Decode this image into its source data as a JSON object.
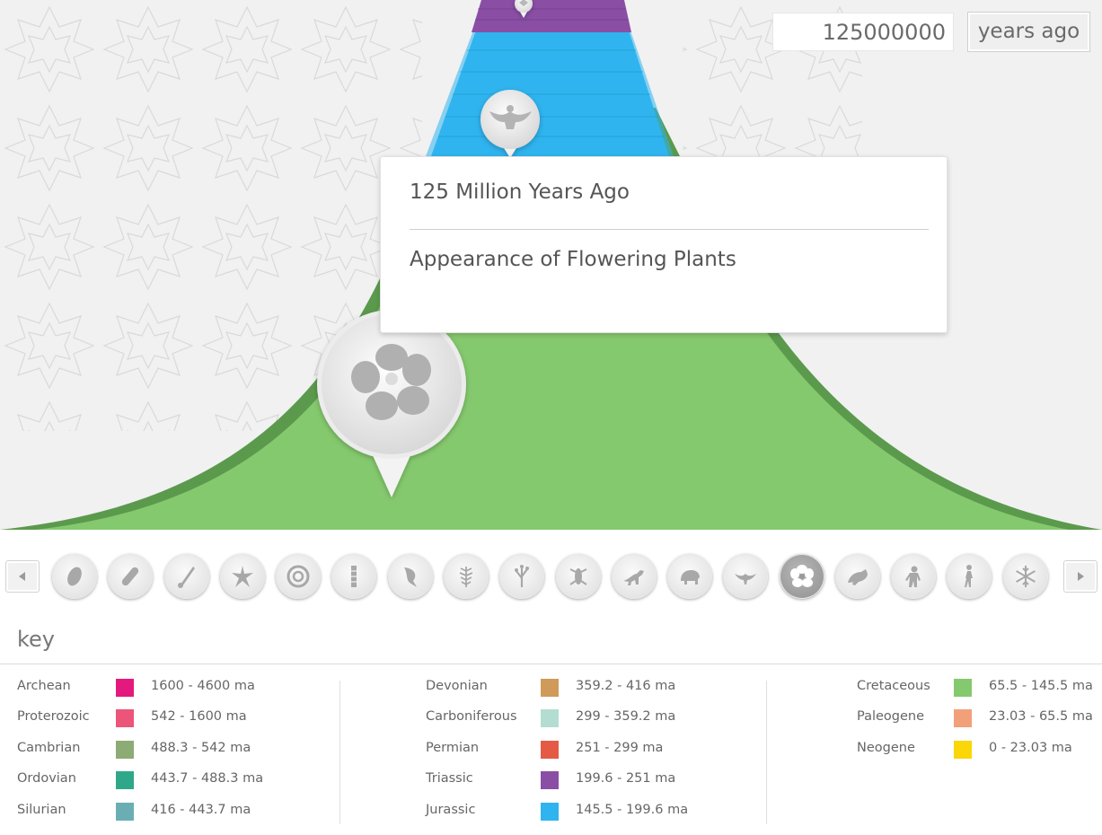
{
  "header": {
    "year_value": "125000000",
    "unit_label": "years ago"
  },
  "event": {
    "date": "125 Million Years Ago",
    "title": "Appearance of Flowering Plants",
    "icon": "flower-icon"
  },
  "timeline_colors": {
    "triassic_band": "#8a4fa5",
    "jurassic_band": "#2fb4ef",
    "cretaceous_band": "#85c96e",
    "cretaceous_edge": "#5b9a4d"
  },
  "nav": {
    "prev_icon": "triangle-left-icon",
    "next_icon": "triangle-right-icon",
    "selected_index": 13,
    "items": [
      {
        "icon": "leaf-cell-icon"
      },
      {
        "icon": "pill-cell-icon"
      },
      {
        "icon": "feather-worm-icon"
      },
      {
        "icon": "starfish-icon"
      },
      {
        "icon": "ammonite-icon"
      },
      {
        "icon": "column-icon"
      },
      {
        "icon": "fish-icon"
      },
      {
        "icon": "fern-icon"
      },
      {
        "icon": "coral-icon"
      },
      {
        "icon": "amphibian-icon"
      },
      {
        "icon": "dinosaur-icon"
      },
      {
        "icon": "mammal-icon"
      },
      {
        "icon": "bird-icon"
      },
      {
        "icon": "flower-icon"
      },
      {
        "icon": "rodent-icon"
      },
      {
        "icon": "ape-icon"
      },
      {
        "icon": "human-icon"
      },
      {
        "icon": "snowflake-icon"
      }
    ]
  },
  "key": {
    "title": "key",
    "columns": [
      [
        {
          "name": "Archean",
          "color": "#e4197e",
          "range": "1600 - 4600 ma"
        },
        {
          "name": "Proterozoic",
          "color": "#ec5579",
          "range": "542 - 1600 ma"
        },
        {
          "name": "Cambrian",
          "color": "#8dab74",
          "range": "488.3 - 542 ma"
        },
        {
          "name": "Ordovian",
          "color": "#2fa88a",
          "range": "443.7 - 488.3 ma"
        },
        {
          "name": "Silurian",
          "color": "#6aaeb4",
          "range": "416 - 443.7 ma"
        }
      ],
      [
        {
          "name": "Devonian",
          "color": "#cf9a5a",
          "range": "359.2 - 416 ma"
        },
        {
          "name": "Carboniferous",
          "color": "#b3ddd1",
          "range": "299 - 359.2 ma"
        },
        {
          "name": "Permian",
          "color": "#e55a45",
          "range": "251 - 299 ma"
        },
        {
          "name": "Triassic",
          "color": "#8a4fa5",
          "range": "199.6 - 251 ma"
        },
        {
          "name": "Jurassic",
          "color": "#2fb4ef",
          "range": "145.5 - 199.6 ma"
        }
      ],
      [
        {
          "name": "Cretaceous",
          "color": "#85c96e",
          "range": "65.5 - 145.5 ma"
        },
        {
          "name": "Paleogene",
          "color": "#f2a07a",
          "range": "23.03 - 65.5 ma"
        },
        {
          "name": "Neogene",
          "color": "#fbd608",
          "range": "0 - 23.03 ma"
        }
      ]
    ]
  }
}
